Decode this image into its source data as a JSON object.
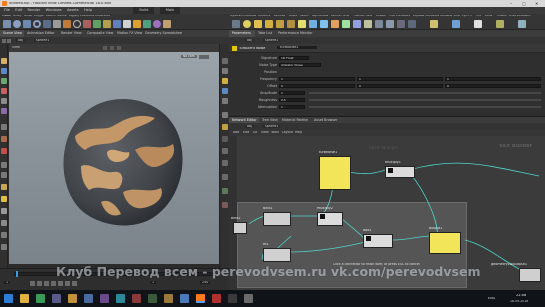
{
  "window": {
    "title": "untitled.hip - Houdini Indie Limited-Commercial 16.0.600",
    "controls": [
      "–",
      "□",
      "✕"
    ]
  },
  "menu": {
    "items": [
      "File",
      "Edit",
      "Render",
      "Windows",
      "Assets",
      "Help",
      "Build",
      "Main"
    ]
  },
  "shelf": {
    "tabs": [
      "Create",
      "Modify",
      "Model",
      "Polygon",
      "Deform",
      "Texture",
      "Rigging",
      "Characters",
      "Constraints",
      "Lights and Cameras",
      "Collisions",
      "Particles",
      "Grains",
      "Vellum",
      "Rigid Bodies",
      "Particle Fluids",
      "Viscous Fluids",
      "Oceans",
      "Fluid Containers",
      "Populate Containers",
      "Container Tools",
      "Pyro FX",
      "FEM",
      "Wires",
      "Crowds",
      "Drive Simulation"
    ]
  },
  "left_pane": {
    "tabs": [
      "Scene View",
      "Animation Editor",
      "Render View",
      "Composite View",
      "Motion FX View",
      "Geometry Spreadsheet"
    ],
    "path": "obj",
    "node": "sphere1",
    "view_label": "View",
    "camera_label": "No cam"
  },
  "timeline": {
    "frame": "1",
    "start": "1",
    "end": "240"
  },
  "param_pane": {
    "tabs": [
      "Parameters",
      "Take List",
      "Performance Monitor"
    ],
    "path": "obj",
    "node": "sphere1",
    "node_type": "Turbulent Noise",
    "node_name": "turbNoise1",
    "rows": [
      {
        "label": "Signature",
        "value": "1D Float"
      },
      {
        "label": "Noise Type",
        "value": "Alligator Noise"
      },
      {
        "label": "Position",
        "value": ""
      },
      {
        "label": "Frequency",
        "values": [
          "1",
          "1",
          "1"
        ]
      },
      {
        "label": "Offset",
        "values": [
          "0",
          "0",
          "0"
        ]
      },
      {
        "label": "Amplitude",
        "value": "1"
      },
      {
        "label": "Roughness",
        "value": "0.5"
      },
      {
        "label": "Attenuation",
        "value": "1"
      }
    ]
  },
  "network_pane": {
    "tabs": [
      "Network Editor",
      "Tree View",
      "Material Palette",
      "Asset Browser"
    ],
    "path": "obj",
    "node": "sphere1",
    "menu_items": [
      "Add",
      "Edit",
      "Go",
      "View",
      "Tools",
      "Layout",
      "Help"
    ],
    "context_label": "VEX Builder",
    "bg_label": "Attrib Wrangle",
    "nodes": [
      {
        "name": "turbnoise1"
      },
      {
        "name": "multiply1"
      },
      {
        "name": "bind1"
      },
      {
        "name": "multiply2"
      },
      {
        "name": "add1"
      },
      {
        "name": "output1"
      },
      {
        "name": "bind2"
      },
      {
        "name": "fit1"
      },
      {
        "name": "geometryvopoutput1"
      }
    ],
    "status": "Click a connector to finish wire, or press ESC to cancel"
  },
  "watermark": {
    "text": "Клуб Перевод всем - perevodvsem.ru  vk.com/perevodvsem"
  },
  "taskbar": {
    "clock_time": "22:08",
    "clock_date": "18.09.2018",
    "lang": "ENG"
  },
  "colors": {
    "accent": "#e5c700",
    "node_yellow": "#f2e55a",
    "wire": "#4fd4cc"
  }
}
